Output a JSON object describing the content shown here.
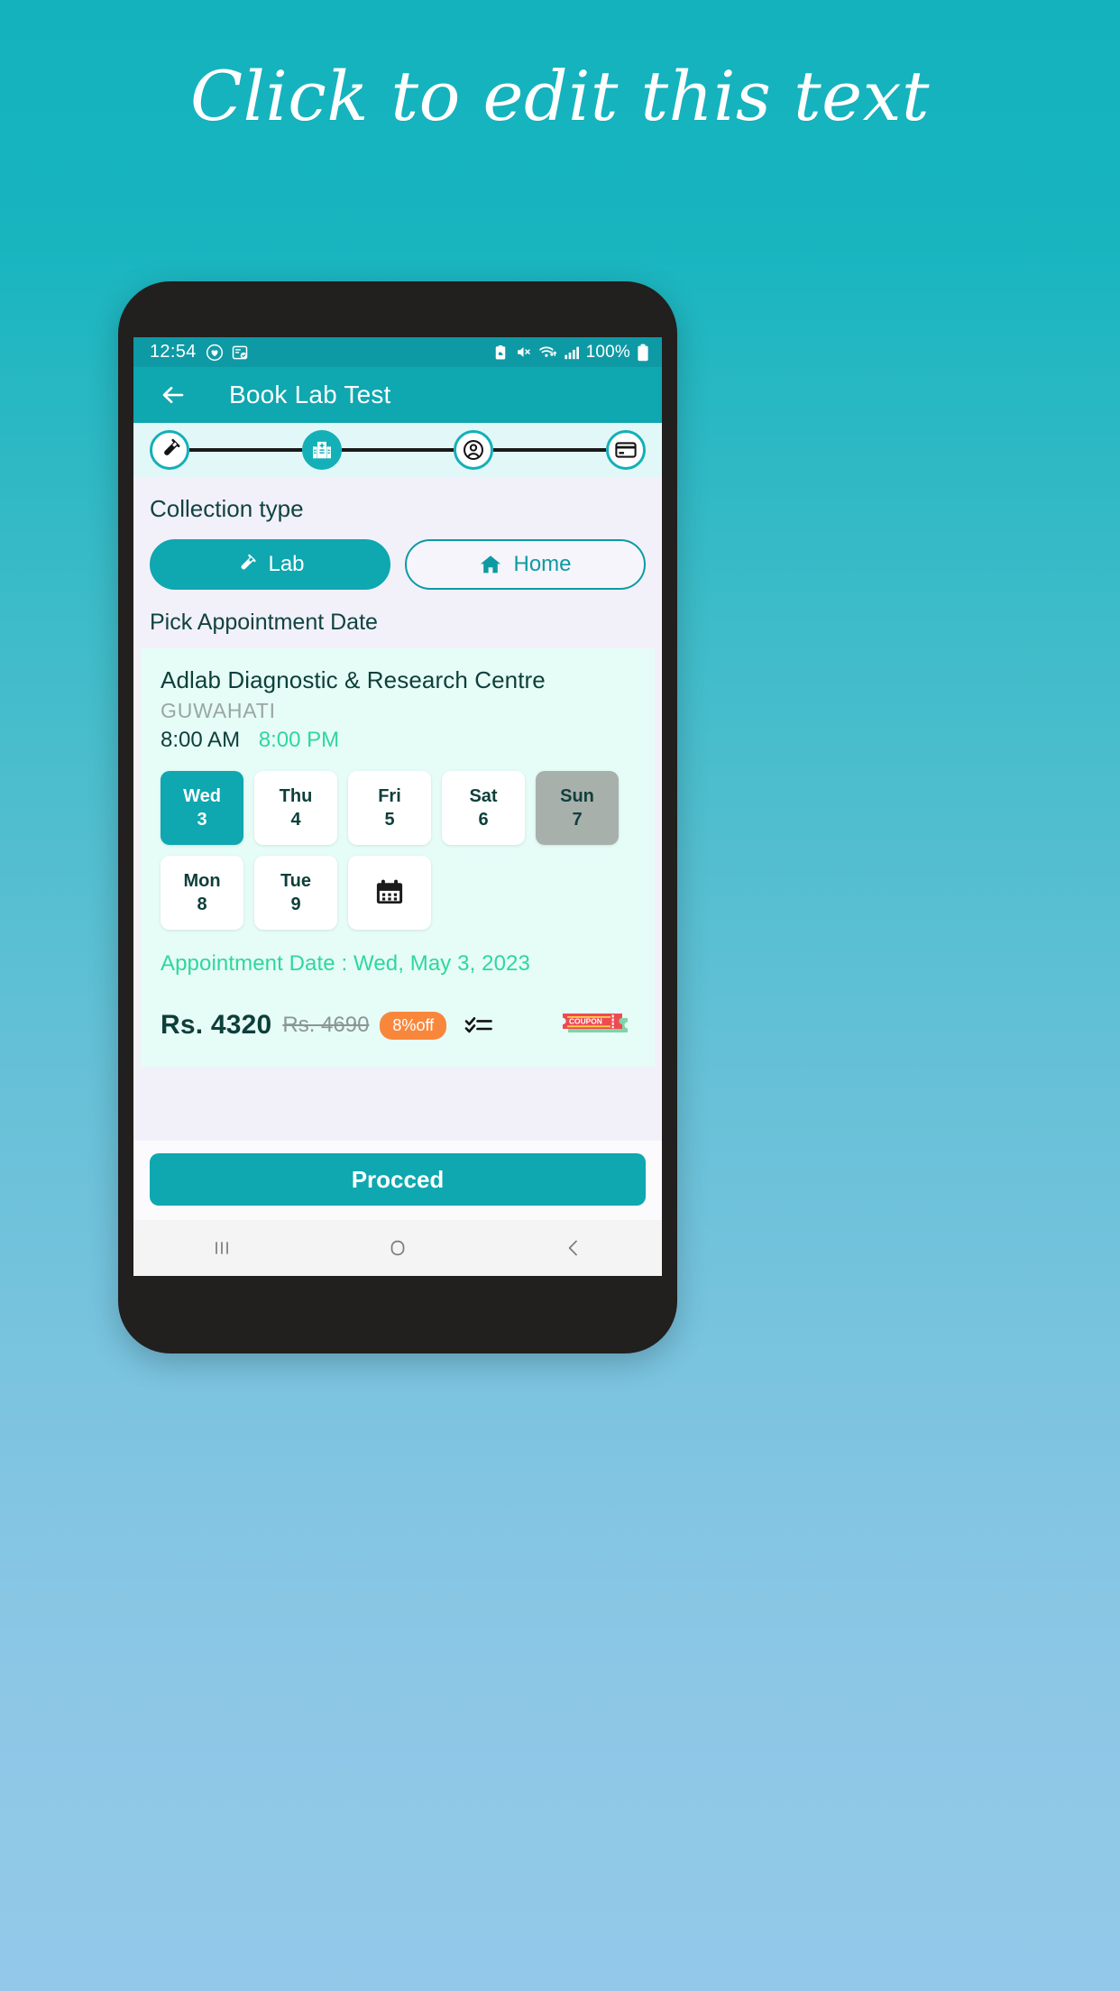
{
  "headline": "Click to edit this text",
  "statusbar": {
    "time": "12:54",
    "left_icons": [
      "heart-circle-icon",
      "task-check-icon"
    ],
    "right_icons": [
      "clipboard-cloud-icon",
      "mute-icon",
      "wifi-transfer-icon",
      "signal-bars-icon"
    ],
    "battery_text": "100%",
    "battery_icon": "battery-full-icon"
  },
  "appbar": {
    "back_icon": "back-arrow-icon",
    "title": "Book Lab Test"
  },
  "stepper": {
    "steps": [
      {
        "name": "test-tube-icon",
        "state": "done"
      },
      {
        "name": "hospital-icon",
        "state": "active"
      },
      {
        "name": "person-icon",
        "state": "pending"
      },
      {
        "name": "credit-card-icon",
        "state": "pending"
      }
    ]
  },
  "collection": {
    "label": "Collection type",
    "options": [
      {
        "label": "Lab",
        "icon": "test-tube-icon",
        "selected": true
      },
      {
        "label": "Home",
        "icon": "home-icon",
        "selected": false
      }
    ]
  },
  "pick_date": {
    "label": "Pick Appointment Date"
  },
  "clinic": {
    "name": "Adlab Diagnostic & Research Centre",
    "city": "GUWAHATI",
    "open_time": "8:00 AM",
    "close_time": "8:00 PM"
  },
  "dates": [
    {
      "dow": "Wed",
      "day": "3",
      "state": "selected"
    },
    {
      "dow": "Thu",
      "day": "4",
      "state": "normal"
    },
    {
      "dow": "Fri",
      "day": "5",
      "state": "normal"
    },
    {
      "dow": "Sat",
      "day": "6",
      "state": "normal"
    },
    {
      "dow": "Sun",
      "day": "7",
      "state": "disabled"
    },
    {
      "dow": "Mon",
      "day": "8",
      "state": "normal"
    },
    {
      "dow": "Tue",
      "day": "9",
      "state": "normal"
    }
  ],
  "calendar_button": {
    "icon": "calendar-icon"
  },
  "appointment_date": "Appointment Date : Wed, May 3, 2023",
  "price": {
    "current": "Rs. 4320",
    "original": "Rs. 4690",
    "discount": "8%off",
    "checklist_icon": "checklist-icon",
    "coupon_label": "COUPON"
  },
  "proceed": {
    "label": "Procced"
  },
  "navbar": {
    "recents_icon": "recents-icon",
    "home_icon": "home-circle-icon",
    "back_icon": "back-chevron-icon"
  },
  "colors": {
    "teal": "#0fa7b0",
    "teal_dark": "#0e9aa5",
    "green": "#2fd79b",
    "orange": "#f8873c",
    "coupon_red": "#ef4a51",
    "card_bg": "#e6fcf7",
    "screen_bg": "#f2f1fa"
  }
}
